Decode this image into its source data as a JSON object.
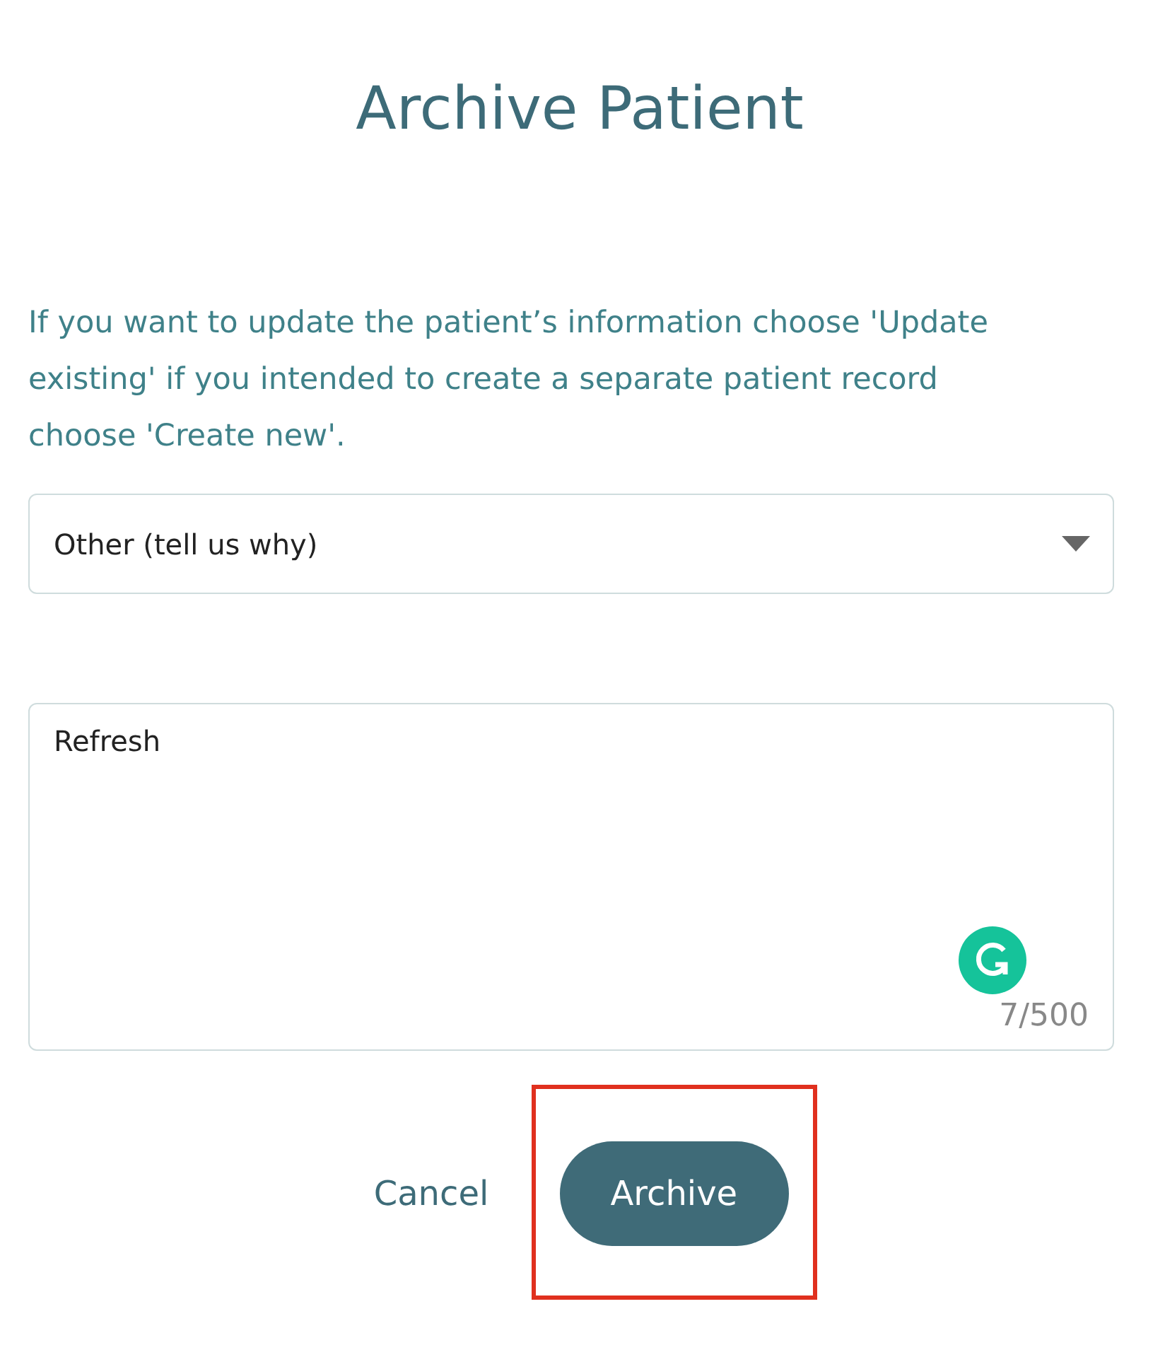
{
  "dialog": {
    "title": "Archive Patient",
    "message": "If you want to update the patient’s information choose 'Update existing' if you intended to create a separate patient record choose 'Create new'.",
    "reason_dropdown": {
      "value": "Other (tell us why)"
    },
    "reason_text": {
      "value": "Refresh",
      "counter": "7/500"
    },
    "buttons": [
      {
        "kind": "text",
        "label": "Cancel",
        "highlighted": false
      },
      {
        "kind": "primary",
        "label": "Archive",
        "highlighted": true
      }
    ]
  }
}
